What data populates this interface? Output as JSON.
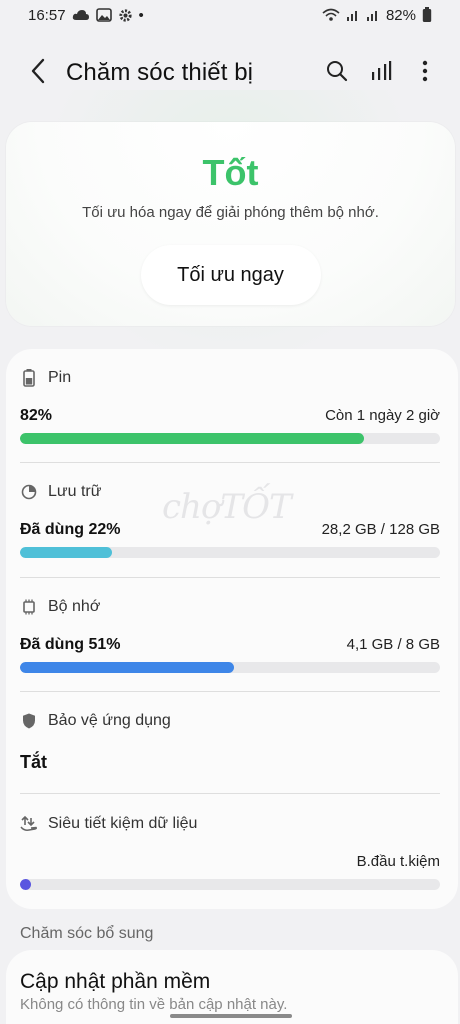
{
  "status_bar": {
    "time": "16:57",
    "dot": "•",
    "battery_percent": "82%",
    "icons_left": [
      "weather-cloud-icon",
      "gallery-icon",
      "settings-gear-icon"
    ],
    "icons_right": [
      "wifi-icon",
      "signal-1-icon",
      "signal-2-icon",
      "battery-icon"
    ]
  },
  "header": {
    "title": "Chăm sóc thiết bị",
    "back_icon": "chevron-left-icon",
    "actions": [
      "search-icon",
      "stats-icon",
      "more-vertical-icon"
    ]
  },
  "hero": {
    "status": "Tốt",
    "description": "Tối ưu hóa ngay để giải phóng thêm bộ nhớ.",
    "button_label": "Tối ưu ngay",
    "status_color": "#3cc36a"
  },
  "sections": {
    "battery": {
      "label": "Pin",
      "value": "82%",
      "right": "Còn 1 ngày 2 giờ",
      "progress": 0.82,
      "color": "#3cc36a"
    },
    "storage": {
      "label": "Lưu trữ",
      "value": "Đã dùng 22%",
      "right": "28,2 GB / 128 GB",
      "progress": 0.22,
      "color": "#4fc0d8"
    },
    "memory": {
      "label": "Bộ nhớ",
      "value": "Đã dùng 51%",
      "right": "4,1 GB / 8 GB",
      "progress": 0.51,
      "color": "#3e86e8"
    },
    "app_protection": {
      "label": "Bảo vệ ứng dụng",
      "value": "Tắt"
    },
    "data_saver": {
      "label": "Siêu tiết kiệm dữ liệu",
      "right": "B.đầu t.kiệm",
      "progress": 0.025,
      "color": "#5a56e0"
    }
  },
  "additional": {
    "heading": "Chăm sóc bổ sung",
    "item_title": "Cập nhật phần mềm",
    "item_subtitle": "Không có thông tin về bản cập nhật này."
  },
  "watermark": "chợTỐT"
}
